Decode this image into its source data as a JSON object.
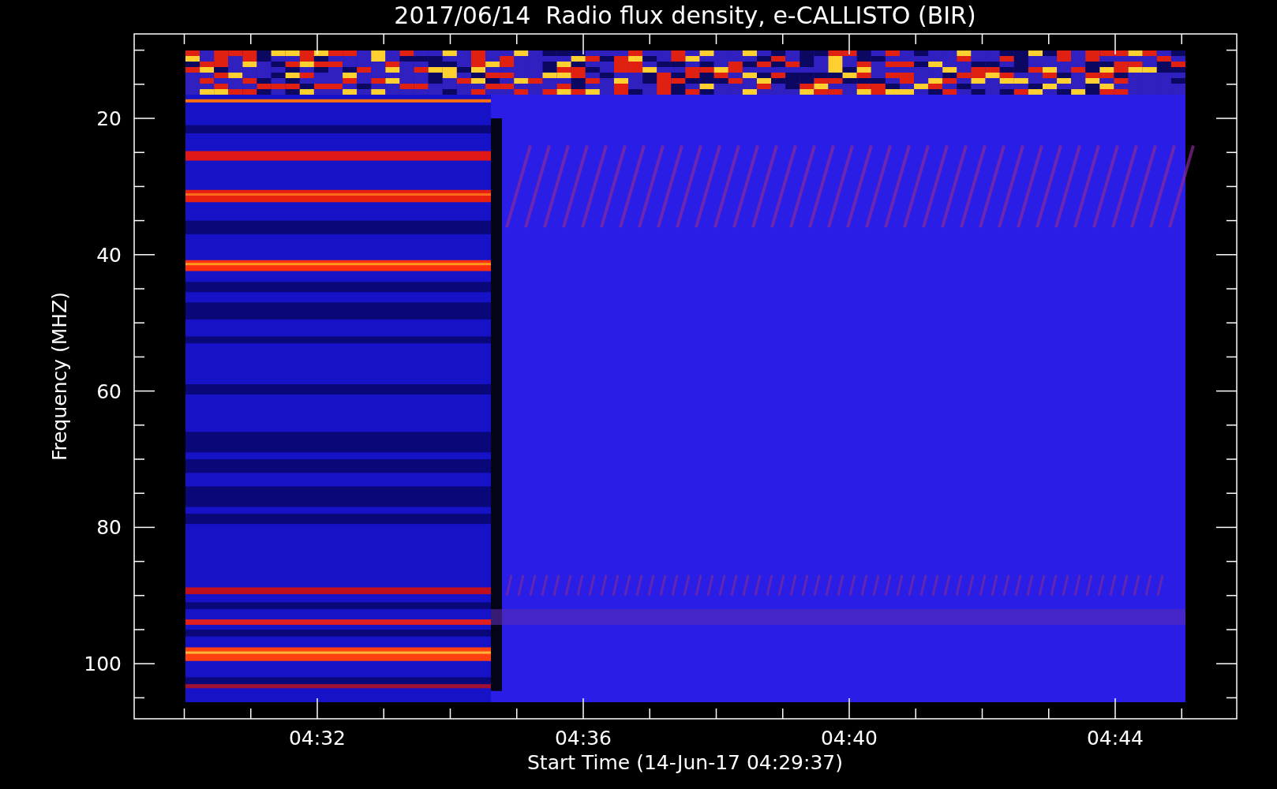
{
  "title": "2017/06/14  Radio flux density, e-CALLISTO (BIR)",
  "ylabel": "Frequency (MHZ)",
  "yticks": [
    "20",
    "40",
    "60",
    "80",
    "100"
  ],
  "xticks": [
    "04:32",
    "04:36",
    "04:40",
    "04:44"
  ],
  "xlabel": "Start Time (14-Jun-17 04:29:37)"
}
